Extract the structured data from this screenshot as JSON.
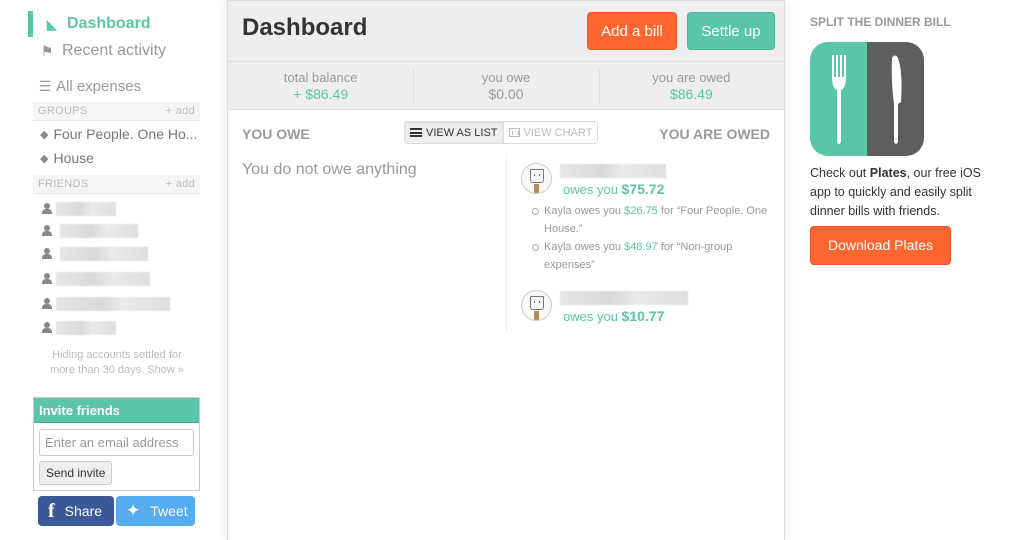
{
  "sidebar": {
    "nav": {
      "dashboard": "Dashboard",
      "recent_activity": "Recent activity",
      "all_expenses": "All expenses"
    },
    "groups_header": "GROUPS",
    "friends_header": "FRIENDS",
    "add_label": "+ add",
    "groups": [
      {
        "name": "Four People. One Ho..."
      },
      {
        "name": "House"
      }
    ],
    "friends_count": 6,
    "hiding_text": "Hiding accounts settled for more than 30 days.",
    "show_link": "Show »",
    "invite": {
      "title": "Invite friends",
      "email_placeholder": "Enter an email address",
      "send_label": "Send invite"
    },
    "share_label": "Share",
    "tweet_label": "Tweet"
  },
  "main": {
    "title": "Dashboard",
    "add_bill_label": "Add a bill",
    "settle_up_label": "Settle up",
    "balances": [
      {
        "label": "total balance",
        "value": "+ $86.49"
      },
      {
        "label": "you owe",
        "value": "$0.00"
      },
      {
        "label": "you are owed",
        "value": "$86.49"
      }
    ],
    "you_owe_header": "YOU OWE",
    "you_are_owed_header": "YOU ARE OWED",
    "view_list_label": "VIEW AS LIST",
    "view_chart_label": "VIEW CHART",
    "nothing_owed": "You do not owe anything",
    "owed": [
      {
        "owes_prefix": "owes you",
        "amount": "$75.72",
        "details": [
          {
            "who": "Kayla owes you",
            "amount": "$26.75",
            "for": "for “Four People. One House.”"
          },
          {
            "who": "Kayla owes you",
            "amount": "$48.97",
            "for": "for “Non-group expenses”"
          }
        ]
      },
      {
        "owes_prefix": "owes you",
        "amount": "$10.77"
      }
    ]
  },
  "promo": {
    "title": "SPLIT THE DINNER BILL",
    "text_pre": "Check out ",
    "text_bold": "Plates",
    "text_post": ", our free iOS app to quickly and easily split dinner bills with friends.",
    "download_label": "Download Plates"
  },
  "colors": {
    "accent_green": "#5bc5a7",
    "accent_orange": "#ff652f",
    "facebook": "#3b5998",
    "twitter": "#55acee"
  }
}
